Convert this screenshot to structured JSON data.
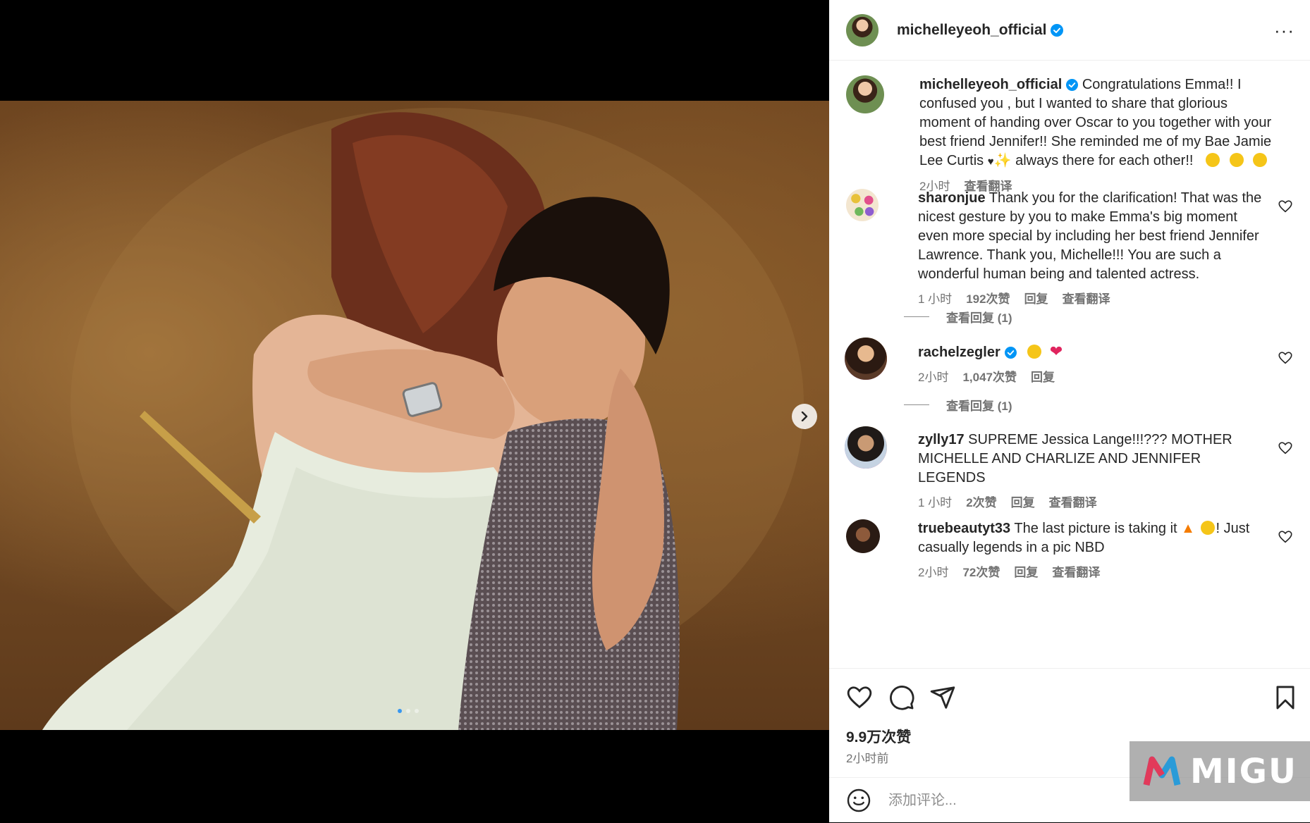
{
  "post": {
    "author": "michelleyeoh_official",
    "more_label": "···"
  },
  "caption": {
    "username": "michelleyeoh_official",
    "text_main": "Congratulations Emma!! I confused you , but I wanted to share that glorious moment of handing over Oscar to you together with your best friend Jennifer!! She reminded me of my Bae Jamie Lee Curtis ",
    "text_tail": " always there for each other!!",
    "time": "2小时",
    "translate": "查看翻译"
  },
  "comments": [
    {
      "username": "sharonjue",
      "text": "Thank you for the clarification! That was the nicest gesture by you to make Emma's big moment even more special by including her best friend Jennifer Lawrence. Thank you, Michelle!!! You are such a wonderful human being and talented actress.",
      "time": "1 小时",
      "likes": "192次赞",
      "reply": "回复",
      "translate": "查看翻译",
      "view_replies": "查看回复 (1)"
    },
    {
      "username": "rachelzegler",
      "text": "",
      "time": "2小时",
      "likes": "1,047次赞",
      "reply": "回复",
      "view_replies": "查看回复 (1)"
    },
    {
      "username": "zylly17",
      "text": "SUPREME Jessica Lange!!!??? MOTHER MICHELLE AND CHARLIZE AND JENNIFER LEGENDS",
      "time": "1 小时",
      "likes": "2次赞",
      "reply": "回复",
      "translate": "查看翻译"
    },
    {
      "username": "truebeautyt33",
      "text_a": "The last picture is taking it ",
      "text_b": "! Just casually legends in a pic NBD",
      "time": "2小时",
      "likes": "72次赞",
      "reply": "回复",
      "translate": "查看翻译"
    }
  ],
  "footer": {
    "likes": "9.9万次赞",
    "time_ago": "2小时前",
    "comment_placeholder": "添加评论..."
  },
  "watermark": {
    "text": "MIGU"
  },
  "colors": {
    "verified": "#0095f6",
    "link_blue": "#3897f0",
    "meta_gray": "#737373"
  }
}
